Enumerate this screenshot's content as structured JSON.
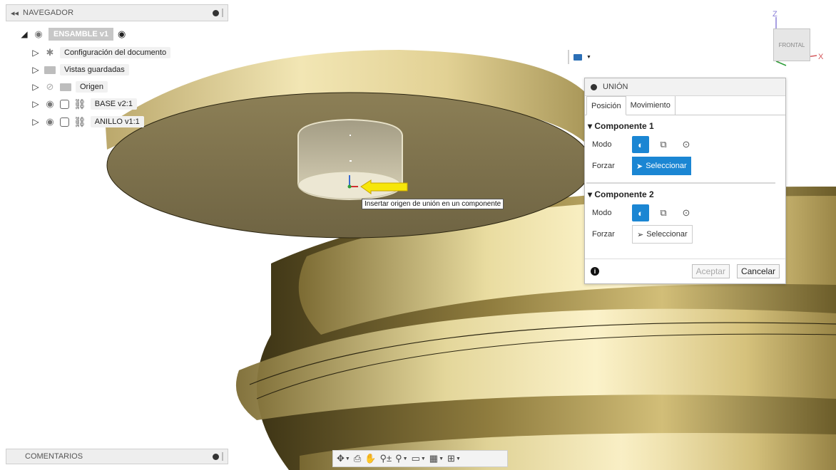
{
  "navigator": {
    "title": "NAVEGADOR",
    "assembly": "ENSAMBLE v1",
    "items": [
      {
        "label": "Configuración del documento"
      },
      {
        "label": "Vistas guardadas"
      },
      {
        "label": "Origen"
      },
      {
        "label": "BASE v2:1"
      },
      {
        "label": "ANILLO v1:1"
      }
    ]
  },
  "comments": {
    "title": "COMENTARIOS"
  },
  "viewcube": {
    "face": "FRONTAL",
    "axis_z": "Z",
    "axis_x": "X"
  },
  "dialog": {
    "title": "UNIÓN",
    "tabs": [
      "Posición",
      "Movimiento"
    ],
    "component1": {
      "header": "Componente 1",
      "mode_label": "Modo",
      "force_label": "Forzar",
      "select_label": "Seleccionar"
    },
    "component2": {
      "header": "Componente 2",
      "mode_label": "Modo",
      "force_label": "Forzar",
      "select_label": "Seleccionar"
    },
    "accept": "Aceptar",
    "cancel": "Cancelar"
  },
  "tooltip": "Insertar origen de unión en un componente",
  "colors": {
    "accent": "#1b86d3",
    "gold": "#c9b67a",
    "arrow": "#f6e60a"
  }
}
